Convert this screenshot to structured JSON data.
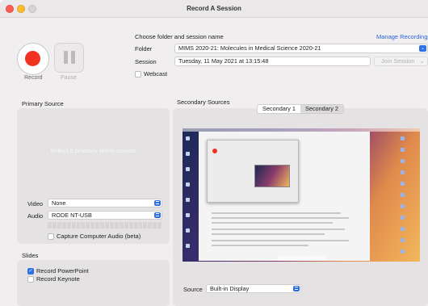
{
  "window": {
    "title": "Record A Session"
  },
  "controls": {
    "record_label": "Record",
    "pause_label": "Pause"
  },
  "header": {
    "choose_label": "Choose folder and session name",
    "manage_link": "Manage Recordings",
    "folder_label": "Folder",
    "folder_value": "MIMS 2020-21: Molecules in Medical Science 2020-21",
    "session_label": "Session",
    "session_value": "Tuesday, 11 May 2021 at 13:15:48",
    "join_label": "Join Session",
    "webcast_label": "Webcast",
    "webcast_checked": false
  },
  "primary": {
    "title": "Primary Source",
    "hint": "Select a primary video source",
    "video_label": "Video",
    "video_value": "None",
    "audio_label": "Audio",
    "audio_value": "RODE NT-USB",
    "capture_label": "Capture Computer Audio (beta)",
    "capture_checked": false
  },
  "slides": {
    "title": "Slides",
    "items": [
      {
        "label": "Record PowerPoint",
        "checked": true
      },
      {
        "label": "Record Keynote",
        "checked": false
      }
    ]
  },
  "secondary": {
    "title": "Secondary Sources",
    "tabs": [
      {
        "label": "Secondary 1",
        "active": true
      },
      {
        "label": "Secondary 2",
        "active": false
      }
    ],
    "source_label": "Source",
    "source_value": "Built-in Display"
  },
  "colors": {
    "accent": "#2e72e6",
    "record": "#f23220",
    "link": "#2a65d8"
  }
}
